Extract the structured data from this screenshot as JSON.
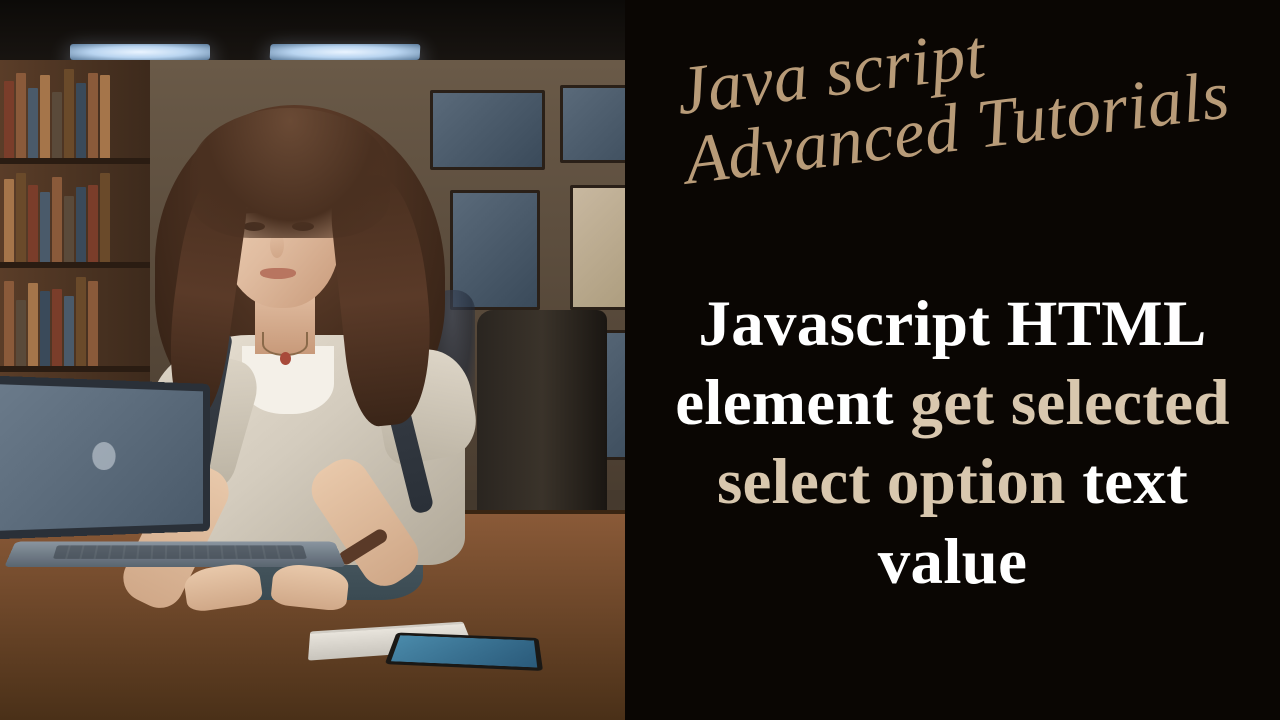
{
  "series": {
    "line1": "Java script",
    "line2": "Advanced Tutorials"
  },
  "title": {
    "seg1": "Javascript HTML element ",
    "seg2": "get selected select option ",
    "seg3": "text value"
  },
  "colors": {
    "series_text": "#b89b78",
    "title_white": "#ffffff",
    "title_tan": "#d8c7ae",
    "background": "#0a0603"
  }
}
